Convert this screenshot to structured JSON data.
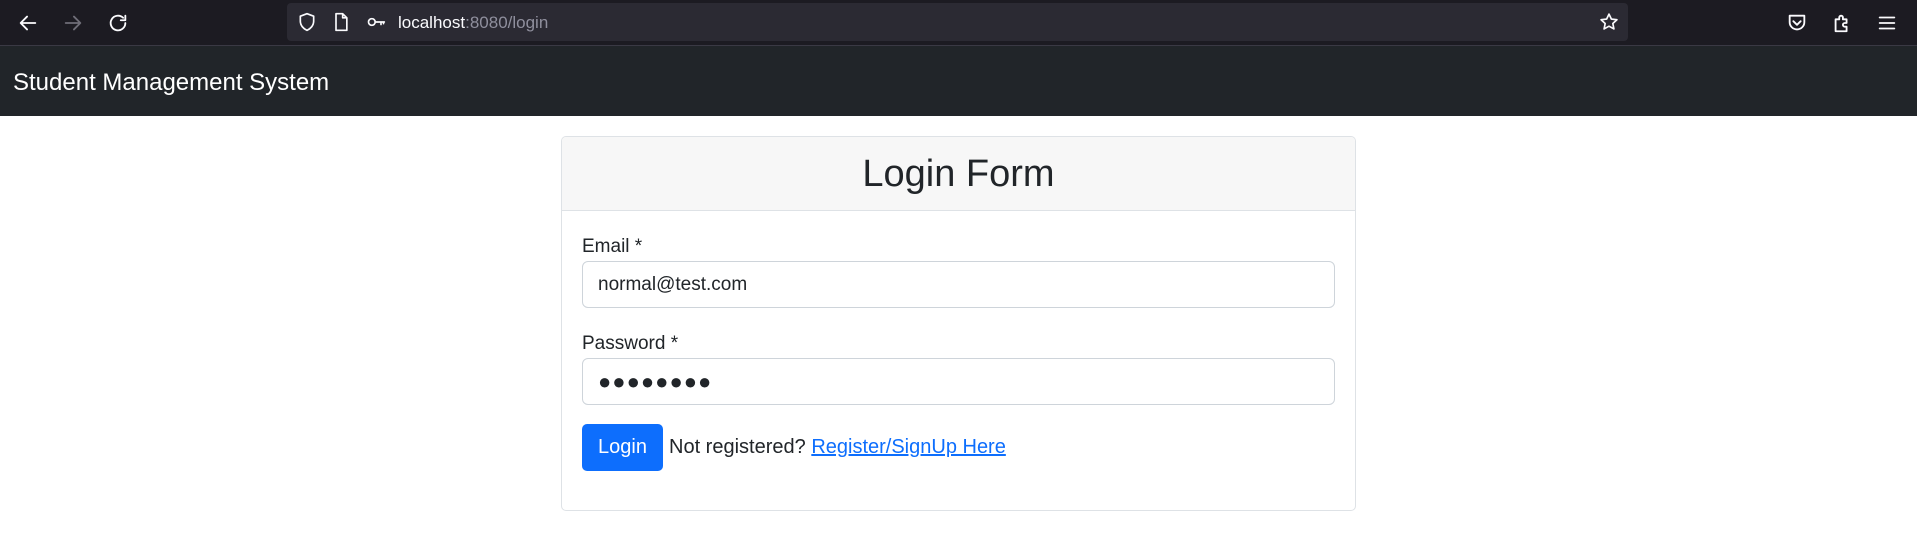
{
  "browser": {
    "url_host": "localhost",
    "url_rest": ":8080/login",
    "icons": {
      "back": "arrow-left-icon",
      "forward": "arrow-right-icon",
      "reload": "reload-icon",
      "tracking": "shield-icon",
      "page": "page-icon",
      "key": "key-icon",
      "bookmark": "star-icon",
      "pocket": "pocket-icon",
      "extensions": "puzzle-icon",
      "menu": "hamburger-menu-icon"
    }
  },
  "navbar": {
    "brand": "Student Management System",
    "background": "#212529"
  },
  "login_card": {
    "title": "Login Form",
    "email": {
      "label": "Email *",
      "value": "normal@test.com"
    },
    "password": {
      "label": "Password *",
      "value": "●●●●●●●●"
    },
    "login_button": "Login",
    "not_registered_text": "Not registered?",
    "register_link": "Register/SignUp Here",
    "accent_color": "#0d6efd"
  }
}
